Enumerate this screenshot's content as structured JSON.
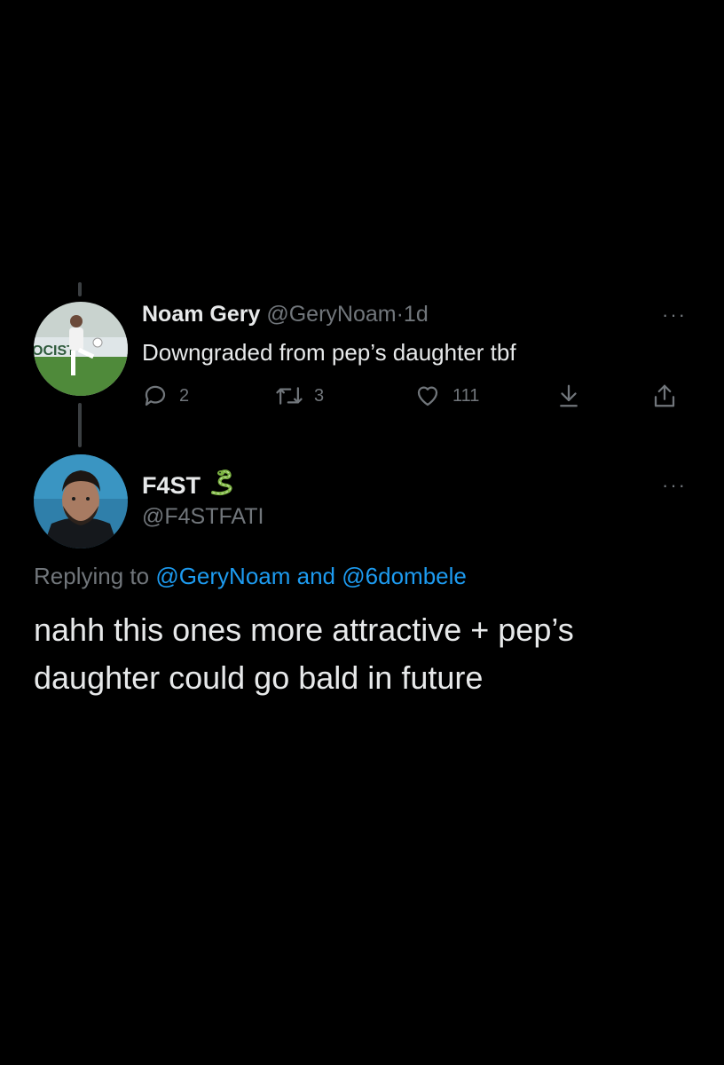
{
  "tweet1": {
    "author_name": "Noam Gery",
    "handle": "@GeryNoam",
    "separator": "·",
    "time": "1d",
    "text": "Downgraded from pep’s daughter tbf",
    "more": "···",
    "reply_count": "2",
    "retweet_count": "3",
    "like_count": "111"
  },
  "tweet2": {
    "author_name": "F4ST",
    "name_emoji": "🐍",
    "handle": "@F4STFATI",
    "more": "···",
    "replying_prefix": "Replying to",
    "reply_to_1": "@GeryNoam",
    "replying_and": "and",
    "reply_to_2": "@6dombele",
    "text": "nahh this ones more attractive + pep’s daughter could go bald in future"
  },
  "colors": {
    "background": "#000000",
    "text": "#e7e9ea",
    "muted": "#71767b",
    "link": "#1d9bf0",
    "thread_line": "#3b3f42"
  },
  "icons": [
    "reply-icon",
    "retweet-icon",
    "like-icon",
    "download-icon",
    "share-icon",
    "more-icon",
    "snake-emoji"
  ]
}
